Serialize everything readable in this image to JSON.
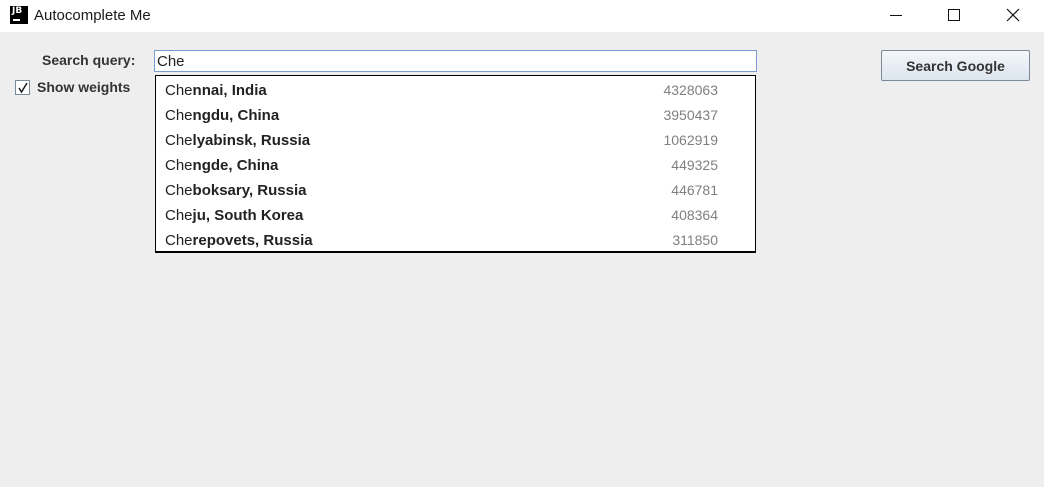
{
  "window": {
    "icon_text": "JB",
    "title": "Autocomplete Me",
    "controls": [
      "minimize-icon",
      "maximize-icon",
      "close-icon"
    ]
  },
  "search": {
    "label": "Search query:",
    "value": "Che"
  },
  "show_weights": {
    "label": "Show weights",
    "checked": true
  },
  "search_google": {
    "label": "Search Google"
  },
  "suggestions": [
    {
      "prefix": "Che",
      "rest": "nnai, India",
      "weight": "4328063"
    },
    {
      "prefix": "Che",
      "rest": "ngdu, China",
      "weight": "3950437"
    },
    {
      "prefix": "Che",
      "rest": "lyabinsk, Russia",
      "weight": "1062919"
    },
    {
      "prefix": "Che",
      "rest": "ngde, China",
      "weight": "449325"
    },
    {
      "prefix": "Che",
      "rest": "boksary, Russia",
      "weight": "446781"
    },
    {
      "prefix": "Che",
      "rest": "ju, South Korea",
      "weight": "408364"
    },
    {
      "prefix": "Che",
      "rest": "repovets, Russia",
      "weight": "311850"
    }
  ]
}
